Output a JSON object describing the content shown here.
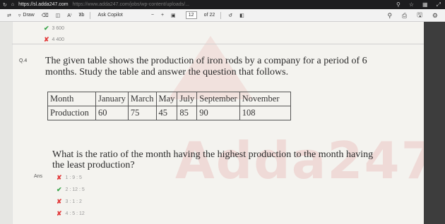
{
  "browser": {
    "url": "https://sl.adda247.com",
    "url_rest": "https://www.adda247.com/jobs/wp-content/uploads/..."
  },
  "toolbar": {
    "draw_label": "Draw",
    "ask_copilot_label": "Ask Copilot",
    "read_aloud_label": "A⁾",
    "text_label": "a̅b",
    "zoom_out": "−",
    "zoom_in": "+",
    "page_current": "12",
    "page_total": "of 22"
  },
  "previous_question": {
    "options": [
      {
        "mark": "correct",
        "text": "3 600"
      },
      {
        "mark": "wrong",
        "text": "4  400"
      }
    ]
  },
  "question": {
    "number": "Q.4",
    "text": "The given table shows the production of iron rods by a company for a period of 6 months. Study the table and answer the question that follows.",
    "table": {
      "header": [
        "Month",
        "January",
        "March",
        "May",
        "July",
        "September",
        "November"
      ],
      "row": [
        "Production",
        "60",
        "75",
        "45",
        "85",
        "90",
        "108"
      ]
    },
    "sub_question": "What is the ratio of the month having the highest production to the month having the least production?"
  },
  "answers": {
    "label": "Ans",
    "options": [
      {
        "mark": "wrong",
        "text": "1 : 9 : 5"
      },
      {
        "mark": "correct",
        "text": "2 : 12 : 5"
      },
      {
        "mark": "wrong",
        "text": "3 : 1 : 2"
      },
      {
        "mark": "wrong",
        "text": "4 : 5 : 12"
      }
    ]
  },
  "watermark": {
    "text": "Adda247"
  },
  "colors": {
    "correct": "#3aa54a",
    "wrong": "#e23b3b"
  }
}
